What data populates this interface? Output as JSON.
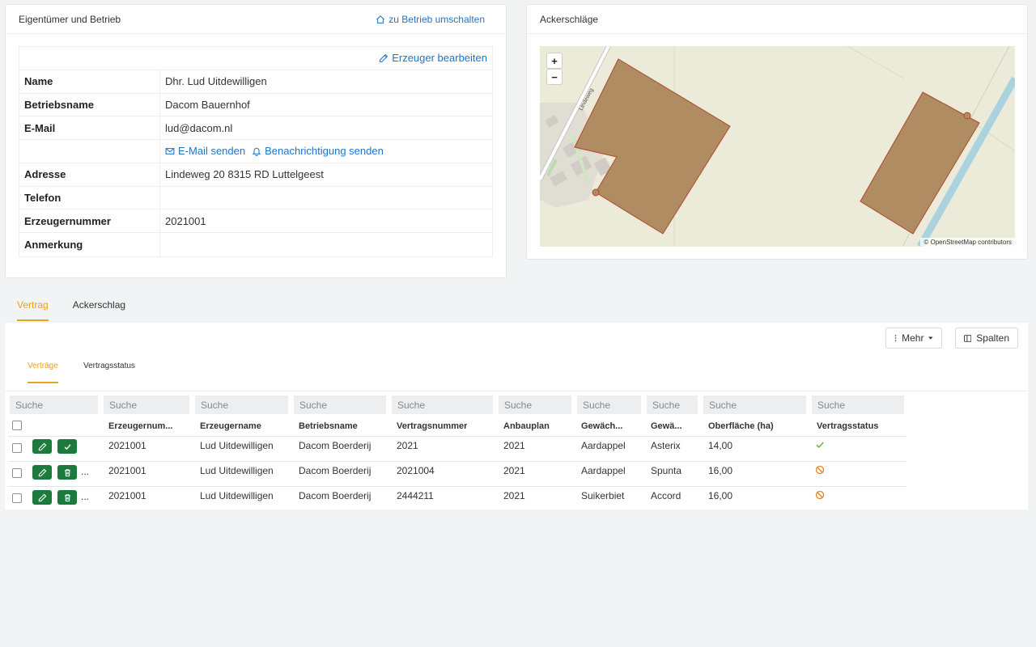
{
  "owner_card": {
    "title": "Eigentümer und Betrieb",
    "switch_link": "zu Betrieb umschalten",
    "edit_link": "Erzeuger bearbeiten",
    "rows": [
      {
        "label": "Name",
        "value": "Dhr. Lud Uitdewilligen"
      },
      {
        "label": "Betriebsname",
        "value": "Dacom Bauernhof"
      },
      {
        "label": "E-Mail",
        "value": "lud@dacom.nl"
      },
      {
        "label": "Adresse",
        "value": "Lindeweg 20 8315 RD Luttelgeest"
      },
      {
        "label": "Telefon",
        "value": ""
      },
      {
        "label": "Erzeugernummer",
        "value": "2021001"
      },
      {
        "label": "Anmerkung",
        "value": ""
      }
    ],
    "email_send": "E-Mail senden",
    "notify_send": "Benachrichtigung senden"
  },
  "map_card": {
    "title": "Ackerschläge",
    "zoom_in": "+",
    "zoom_out": "−",
    "road_label": "Lindeweg",
    "attribution": "© OpenStreetMap contributors"
  },
  "tabs": [
    "Vertrag",
    "Ackerschlag"
  ],
  "toolbar": {
    "more": "Mehr",
    "columns": "Spalten"
  },
  "subtabs": [
    "Verträge",
    "Vertragsstatus"
  ],
  "search_placeholder": "Suche",
  "columns": [
    "Erzeugernum...",
    "Erzeugername",
    "Betriebsname",
    "Vertragsnummer",
    "Anbauplan",
    "Gewäch...",
    "Gewä...",
    "Oberfläche (ha)",
    "Vertragsstatus"
  ],
  "rows": [
    {
      "erzeugernummer": "2021001",
      "erzeugername": "Lud Uitdewilligen",
      "betriebsname": "Dacom Boerderij",
      "vertragsnummer": "2021",
      "anbauplan": "2021",
      "gewaechs": "Aardappel",
      "sorte": "Asterix",
      "oberflaeche": "14,00",
      "status": "approved"
    },
    {
      "erzeugernummer": "2021001",
      "erzeugername": "Lud Uitdewilligen",
      "betriebsname": "Dacom Boerderij",
      "vertragsnummer": "2021004",
      "anbauplan": "2021",
      "gewaechs": "Aardappel",
      "sorte": "Spunta",
      "oberflaeche": "16,00",
      "status": "blocked"
    },
    {
      "erzeugernummer": "2021001",
      "erzeugername": "Lud Uitdewilligen",
      "betriebsname": "Dacom Boerderij",
      "vertragsnummer": "2444211",
      "anbauplan": "2021",
      "gewaechs": "Suikerbiet",
      "sorte": "Accord",
      "oberflaeche": "16,00",
      "status": "blocked"
    }
  ],
  "more_dots": "...",
  "colors": {
    "accent": "#e9a21c",
    "link": "#1f74c9",
    "action": "#1c7a3c",
    "approved": "#6db33f",
    "blocked": "#e8832a",
    "field_fill": "#b08c63",
    "field_stroke": "#b0472a"
  }
}
